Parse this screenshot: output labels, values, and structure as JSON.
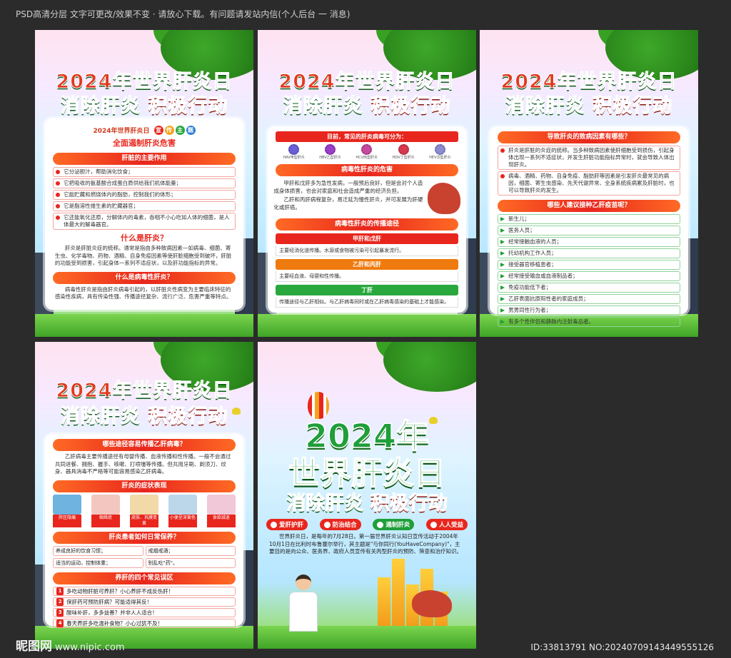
{
  "top_notice": "PSD高清分层 文字可更改/效果不变 · 请放心下载。有问题请发站内信(个人后台 一 消息)",
  "common": {
    "title_year": "2024年",
    "title_rest": "世界肝炎日",
    "slogan_a": "消除肝炎",
    "slogan_b": "积极行动"
  },
  "p1": {
    "theme_label": "2024年世界肝炎日",
    "theme_badges": [
      "宣",
      "传",
      "主",
      "题"
    ],
    "theme_text": "全面遏制肝炎危害",
    "sec_function": "肝脏的主要作用",
    "functions": [
      "它分泌胆汁，帮助消化饮食；",
      "它把吸收的氨基酸合成蛋白质供给我们机体能量；",
      "它能贮藏和燃烧体内的脂肪，控制我们的体形；",
      "它是脂溶性维生素的贮藏器官；",
      "它还能氧化还原，分解体内的毒素，吞咽不小心吃如人体的细菌，是人体最大的解毒器官。"
    ],
    "q_what": "什么是肝炎？",
    "what_text": "肝炎是肝脏炎症的统称。通常是指由多种致病因素—如病毒、细菌、寄生虫、化学毒物、药物、酒精、自身免疫因素等使肝脏细胞受到破坏，肝脏的功能受到损害，引起身体一系列不适症状，以及肝功能指标的异常。",
    "q_viral": "什么是病毒性肝炎？",
    "viral_text": "病毒性肝炎是指由肝炎病毒引起的，以肝脏炎性病变为主要临床特征的感染性疾病，具有传染性强、传播途径复杂、流行广泛、危害严重等特点。"
  },
  "p2": {
    "virus_head": "目前，常见的肝炎病毒可分为：",
    "viruses": [
      "HAV甲型肝炎",
      "HBV乙型肝炎",
      "HCV丙型肝炎",
      "HDV丁型肝炎",
      "HEV戊型肝炎"
    ],
    "sec_harm": "病毒性肝炎的危害",
    "harm_text_1": "甲肝和戊肝多为急性发病，一般预后良好，但是会对个人造成身体损害，也会对家庭和社会造成严重的经济负担。",
    "harm_text_2": "乙肝和丙肝病程复杂，易迁延为慢性肝炎，并可发展为肝硬化或肝癌。",
    "sec_route": "病毒性肝炎的传播途径",
    "route_ae": "甲肝和戊肝",
    "route_ae_text": "主要经消化道传播。水源或食物被污染可引起暴发流行。",
    "route_bc": "乙肝和丙肝",
    "route_bc_text": "主要经血液、母婴和性传播。",
    "route_d": "丁肝",
    "route_d_text": "传播途径与乙肝相似。与乙肝病毒同时或在乙肝病毒感染的基础上才能感染。"
  },
  "p3": {
    "sec_cause": "导致肝炎的致病因素有哪些？",
    "causes": [
      "肝炎是肝脏的炎症的统称。当多种致病因素使肝细胞受到损伤，引起身体出现一系列不适症状，并发生肝脏功能指标异常时，就会导致人体出现肝炎。",
      "病毒、酒精、药物、自身免疫、脂肪肝等因素是引发肝炎最常见的病因，细菌、寄生虫感染、先天代谢异常、全身系统疾病累及肝脏时，也可以导致肝炎的发生。"
    ],
    "sec_vaccine": "哪些人建议接种乙肝疫苗呢？",
    "groups": [
      "新生儿；",
      "医务人员；",
      "经常接触血液的人员；",
      "托幼机构工作人员；",
      "接受器官移植患者；",
      "经常接受输血或血液制品者；",
      "免疫功能低下者；",
      "乙肝表面抗原阳性者的家庭成员；",
      "男男同性行为者；",
      "有多个性伴侣和静脉内注射毒品者。"
    ]
  },
  "p4": {
    "sec_route": "哪些途径容易传播乙肝病毒？",
    "route_text": "乙肝病毒主要传播途径有母婴传播、血液传播和性传播。一般不会通过共同进餐、拥抱、握手、咳嗽、打喷嚏等传播。但共用牙刷、剃须刀、纹身、器具消毒不严格等可能容易感染乙肝病毒。",
    "sec_symptom": "肝炎的症状表现",
    "symptoms": [
      "肝区隐痛",
      "蜘蛛痣",
      "皮肤、巩膜变黄",
      "小便呈深黄色",
      "食欲减退"
    ],
    "sec_care": "肝炎患者如何日常保养？",
    "care": [
      "养成良好的饮食习惯；",
      "戒烟戒酒；",
      "适当的运动，控制体重；",
      "别乱吃\"药\"。"
    ],
    "sec_myth": "养肝的四个常见误区",
    "myths": [
      "多吃动物肝脏可养肝？小心养肝不成反伤肝！",
      "保肝药可预防肝病？可能适得其反！",
      "酸味补肝，多多益善？并非人人适合！",
      "春天养肝多吃温补食物？小心过犹不及！"
    ]
  },
  "p5": {
    "tags": [
      "爱肝护肝",
      "防治结合",
      "遏制肝炎",
      "人人受益"
    ],
    "intro": "世界肝炎日，是每年的7月28日。第一届世界肝炎认知日宣传活动于2004年10月1日在比利时布鲁塞尔举行，其主题是\"与你同行(YouHaveCompany)\"，主要目的是向公众、医务界、政府人员宣传有关丙型肝炎的预防、筛查和治疗知识。"
  },
  "footer": {
    "logo": "昵图网",
    "logo_url": "www.nipic.com",
    "id_text": "ID:33813791 NO:20240709143449555126"
  },
  "colors": {
    "red": "#e8261d",
    "green": "#1f9e3a",
    "orange": "#f4a21c",
    "dark_bg": "#2b2b2b"
  }
}
